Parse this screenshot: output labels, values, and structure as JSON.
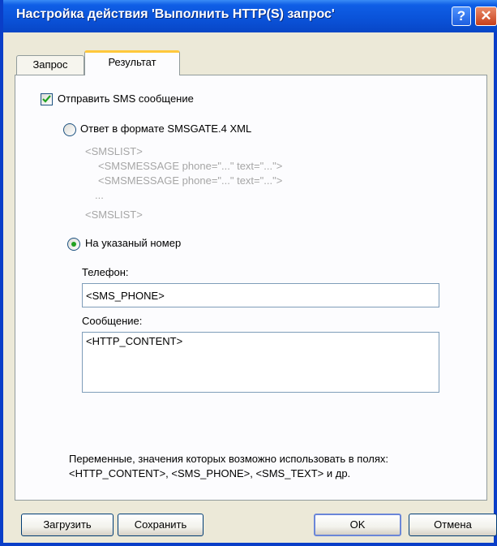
{
  "window": {
    "title": "Настройка действия 'Выполнить HTTP(S) запрос'"
  },
  "titlebar": {
    "help_glyph": "?",
    "close_glyph": "✕"
  },
  "tabs": [
    {
      "label": "Запрос",
      "active": false
    },
    {
      "label": "Результат",
      "active": true
    }
  ],
  "send_sms": {
    "label": "Отправить SMS сообщение",
    "checked": true
  },
  "response_format": {
    "label": "Ответ в формате SMSGATE.4 XML",
    "selected": false,
    "example_lines": [
      "<SMSLIST>",
      "<SMSMESSAGE phone=\"...\" text=\"...\">",
      "<SMSMESSAGE phone=\"...\" text=\"...\">",
      "...",
      "<SMSLIST>"
    ]
  },
  "specified_number": {
    "label": "На указаный номер",
    "selected": true
  },
  "phone": {
    "label": "Телефон:",
    "value": "<SMS_PHONE>"
  },
  "message": {
    "label": "Сообщение:",
    "value": "<HTTP_CONTENT>"
  },
  "hint": {
    "line1": "Переменные, значения которых возможно использовать в полях:",
    "line2": "<HTTP_CONTENT>, <SMS_PHONE>, <SMS_TEXT>  и др."
  },
  "buttons": {
    "load": "Загрузить",
    "save": "Сохранить",
    "ok": "OK",
    "cancel": "Отмена"
  },
  "colors": {
    "titlebar": "#0a52d8",
    "dialog_bg": "#ece9d8",
    "panel_bg": "#fcfcfe",
    "active_tab_accent": "#ffc83c",
    "check_mark": "#21a121",
    "example_text": "#a6a6a6"
  }
}
